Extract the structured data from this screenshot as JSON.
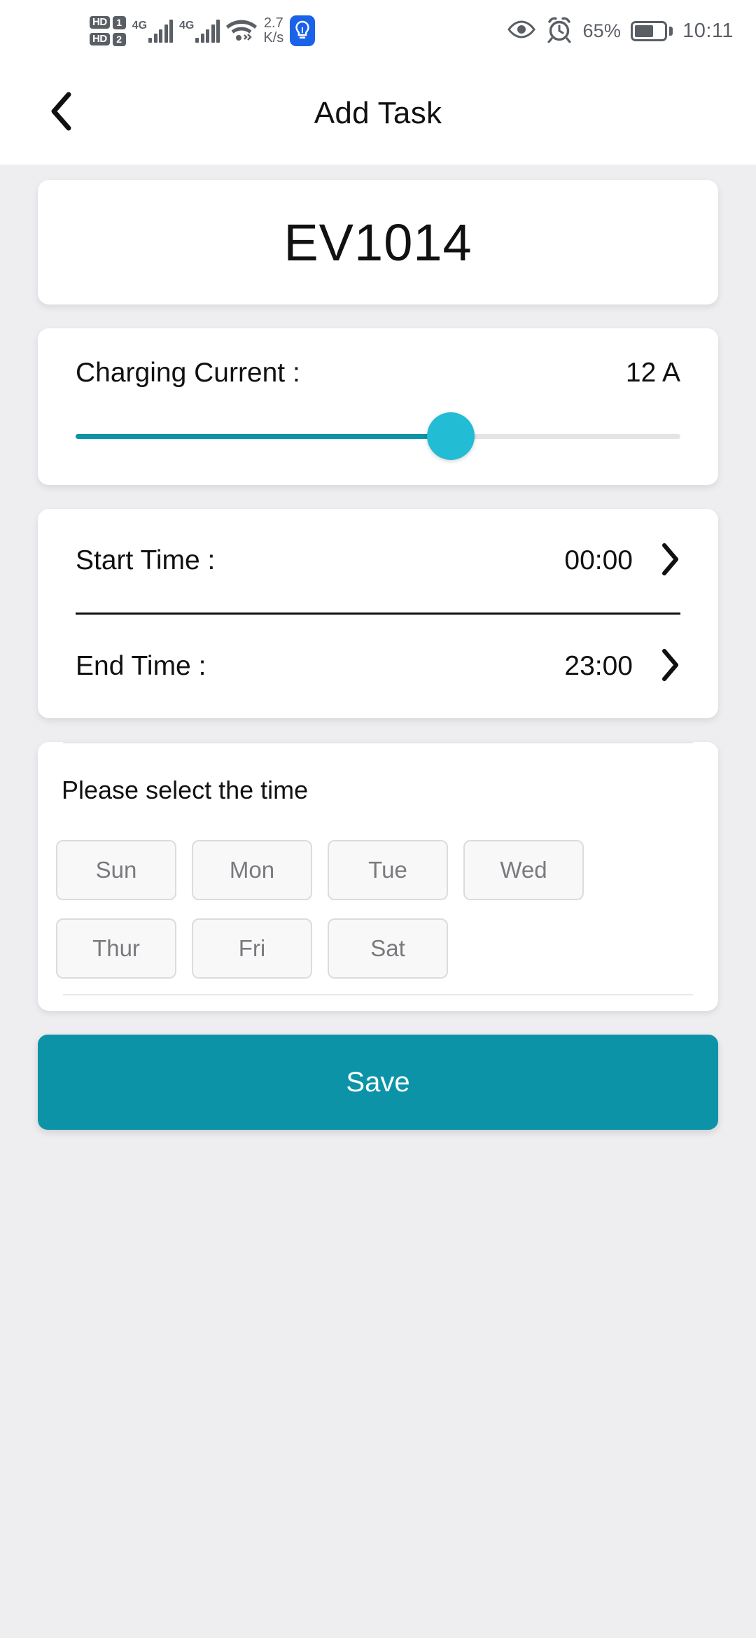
{
  "statusbar": {
    "hd1_label": "HD",
    "sim1_label": "1",
    "hd2_label": "HD",
    "sim2_label": "2",
    "network1": "4G",
    "network2": "4G",
    "netspeed_value": "2.7",
    "netspeed_unit": "K/s",
    "bulb_icon": "lightbulb-icon",
    "eye_icon": "eye-icon",
    "alarm_icon": "alarm-clock-icon",
    "battery_percent": "65%",
    "battery_level": 65,
    "time": "10:11"
  },
  "header": {
    "back_icon": "chevron-left-icon",
    "title": "Add Task"
  },
  "device": {
    "name": "EV1014"
  },
  "charging": {
    "label": "Charging Current :",
    "value": "12 A",
    "slider_percent": 62,
    "track_color": "#e4e4e6",
    "fill_color": "#0d93a8",
    "thumb_color": "#22bcd4"
  },
  "times": [
    {
      "label": "Start Time :",
      "value": "00:00",
      "chevron": "chevron-right-icon"
    },
    {
      "label": "End Time :",
      "value": "23:00",
      "chevron": "chevron-right-icon"
    }
  ],
  "days": {
    "hint": "Please select the time",
    "row1": [
      {
        "label": "Sun",
        "selected": false
      },
      {
        "label": "Mon",
        "selected": false
      },
      {
        "label": "Tue",
        "selected": false
      },
      {
        "label": "Wed",
        "selected": false
      }
    ],
    "row2": [
      {
        "label": "Thur",
        "selected": false
      },
      {
        "label": "Fri",
        "selected": false
      },
      {
        "label": "Sat",
        "selected": false
      }
    ]
  },
  "save": {
    "label": "Save",
    "color": "#0d93a8"
  }
}
